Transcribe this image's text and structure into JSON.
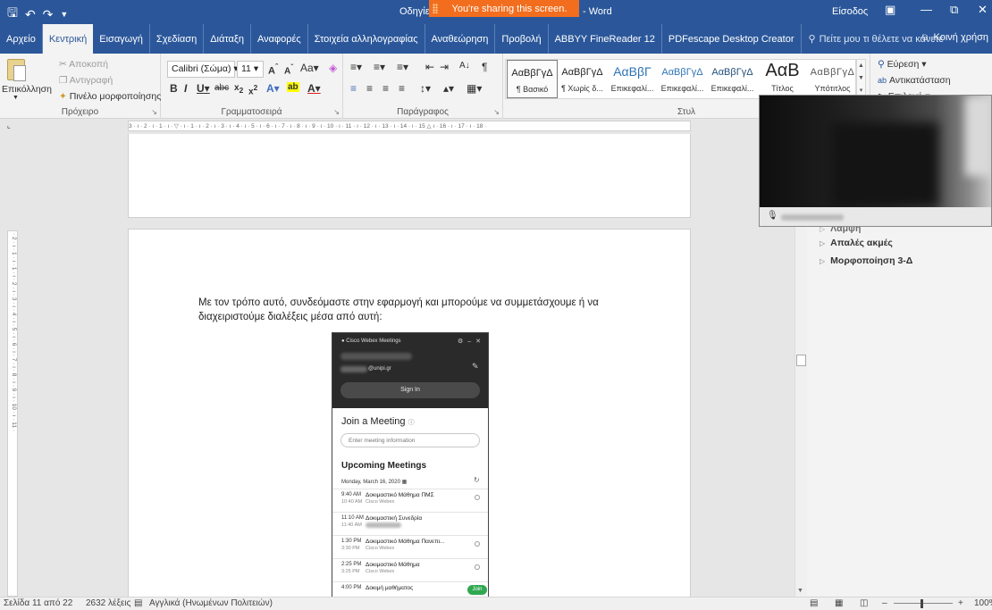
{
  "titlebar": {
    "doc_title_left": "Οδηγίες",
    "doc_title_right": "- Word",
    "sharing_banner": "You're sharing this screen.",
    "signin": "Είσοδος",
    "icons": [
      "save-icon",
      "undo-icon",
      "redo-icon",
      "customize-qat-icon"
    ]
  },
  "tabs": [
    {
      "label": "Αρχείο"
    },
    {
      "label": "Κεντρική"
    },
    {
      "label": "Εισαγωγή"
    },
    {
      "label": "Σχεδίαση"
    },
    {
      "label": "Διάταξη"
    },
    {
      "label": "Αναφορές"
    },
    {
      "label": "Στοιχεία αλληλογραφίας"
    },
    {
      "label": "Αναθεώρηση"
    },
    {
      "label": "Προβολή"
    },
    {
      "label": "ABBYY FineReader 12"
    },
    {
      "label": "PDFescape Desktop Creator"
    }
  ],
  "tellme": "Πείτε μου τι θέλετε να κάνετε",
  "share": "Κοινή χρήση",
  "ribbon": {
    "clipboard": {
      "paste": "Επικόλληση",
      "cut": "Αποκοπή",
      "copy": "Αντιγραφή",
      "format_painter": "Πινέλο μορφοποίησης",
      "label": "Πρόχειρο"
    },
    "font": {
      "family": "Calibri (Σώμα)",
      "size": "11",
      "label": "Γραμματοσειρά"
    },
    "paragraph": {
      "label": "Παράγραφος"
    },
    "styles": {
      "label": "Στυλ",
      "items": [
        {
          "preview": "ΑαΒβΓγΔ",
          "name": "¶ Βασικό"
        },
        {
          "preview": "ΑαΒβΓγΔ",
          "name": "¶ Χωρίς δ..."
        },
        {
          "preview": "ΑαΒβΓ",
          "name": "Επικεφαλί..."
        },
        {
          "preview": "ΑαΒβΓγΔ",
          "name": "Επικεφαλί..."
        },
        {
          "preview": "ΑαΒβΓγΔ",
          "name": "Επικεφαλί..."
        },
        {
          "preview": "ΑαΒ",
          "name": "Τίτλος"
        },
        {
          "preview": "ΑαΒβΓγΔ",
          "name": "Υπότιτλος"
        }
      ]
    },
    "editing": {
      "find": "Εύρεση",
      "replace": "Αντικατάσταση",
      "select": "Επιλογή"
    }
  },
  "document": {
    "paragraph": "Με τον τρόπο αυτό, συνδεόμαστε στην εφαρμογή και μπορούμε να συμμετάσχουμε ή να διαχειριστούμε διαλέξεις μέσα από αυτή:"
  },
  "webex": {
    "title": "Cisco Webex Meetings",
    "email_suffix": "@unipi.gr",
    "sign_in": "Sign In",
    "join_heading": "Join a Meeting",
    "input_placeholder": "Enter meeting information",
    "upcoming_heading": "Upcoming Meetings",
    "date": "Monday, March 16, 2020",
    "meetings": [
      {
        "start": "9:40 AM",
        "end": "10:40 AM",
        "name": "Δοκιμαστικό Μάθημα ΠΜΣ",
        "host": "Cisco Webex"
      },
      {
        "start": "11:10 AM",
        "end": "11:40 AM",
        "name": "Δοκιμαστική Συνεδρία",
        "host": ""
      },
      {
        "start": "1:30 PM",
        "end": "3:30 PM",
        "name": "Δοκιμαστικό Μάθημα Πανεπι...",
        "host": "Cisco Webex"
      },
      {
        "start": "2:25 PM",
        "end": "3:25 PM",
        "name": "Δοκιμαστικό Μάθημα",
        "host": "Cisco Webex"
      },
      {
        "start": "4:00 PM",
        "end": "",
        "name": "Δοκιμή μαθήματος",
        "host": "",
        "join": "Join"
      }
    ]
  },
  "pane": {
    "items": [
      "Λάμψη",
      "Απαλές ακμές",
      "Μορφοποίηση 3-Δ"
    ]
  },
  "status": {
    "page": "Σελίδα 11 από 22",
    "words": "2632 λέξεις",
    "language": "Αγγλικά (Ηνωμένων Πολιτειών)",
    "zoom": "100%"
  },
  "ruler": {
    "h": "3 · ı · 2 · ı · 1 · ı · ▽ · ı · 1 · ı · 2 · ı · 3 · ı · 4 · ı · 5 · ı · 6 · ı · 7 · ı · 8 · ı · 9 · ı · 10 · ı · 11 · ı · 12 · ı · 13 · ı · 14 · ı · 15 △ ı · 16 · ı · 17 · ı · 18 ·",
    "v": "· 2 · ı · 1 · ı · 1 · ı · 2 · ı · 3 · ı · 4 · ı · 5 · ı · 6 · ı · 7 · ı · 8 · ı · 9 · ı · 10 · ı · 11 ·"
  }
}
